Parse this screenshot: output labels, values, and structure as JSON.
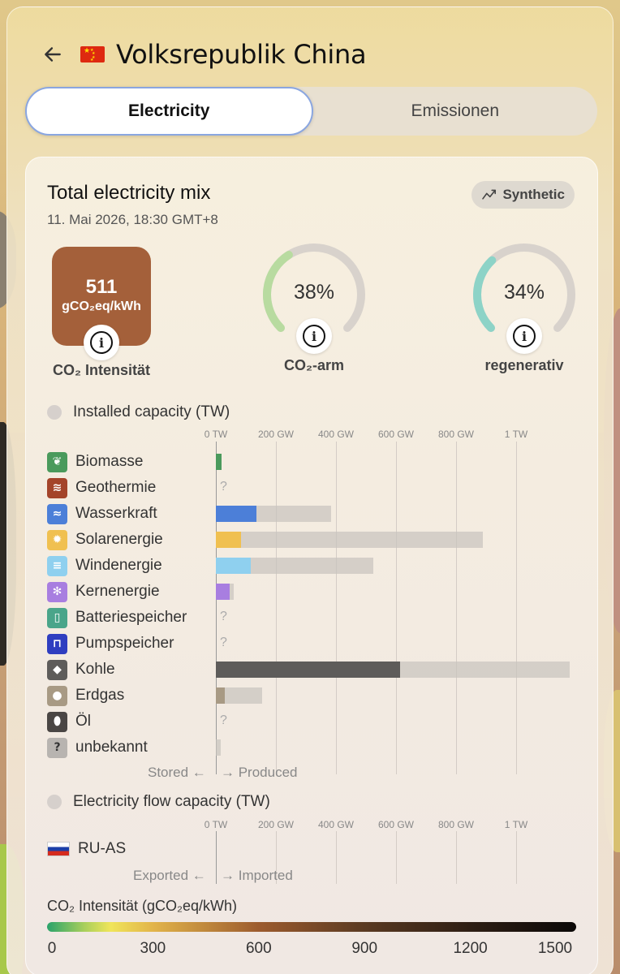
{
  "header": {
    "title": "Volksrepublik China"
  },
  "tabs": [
    {
      "label": "Electricity",
      "active": true
    },
    {
      "label": "Emissionen",
      "active": false
    }
  ],
  "card": {
    "title": "Total electricity mix",
    "date": "11. Mai 2026, 18:30 GMT+8",
    "badge": "Synthetic"
  },
  "metrics": {
    "intensity_value": "511",
    "intensity_unit": "gCO₂eq/kWh",
    "intensity_label": "CO₂ Intensität",
    "low_carbon_value": "38%",
    "low_carbon_fraction": 0.38,
    "low_carbon_label": "CO₂-arm",
    "renewable_value": "34%",
    "renewable_fraction": 0.34,
    "renewable_label": "regenerativ",
    "intensity_color": "#a4603a",
    "low_carbon_color": "#b8dba0",
    "renewable_color": "#8dd3c7"
  },
  "capacity": {
    "title": "Installed capacity (TW)",
    "axis_ticks": [
      "0 TW",
      "200 GW",
      "400 GW",
      "600 GW",
      "800 GW",
      "1 TW"
    ],
    "rows": [
      {
        "label": "Biomasse",
        "icon": "leaf-icon",
        "color": "#4a9a5c",
        "produced_gw": 18,
        "capacity_gw": 18,
        "unknown": false
      },
      {
        "label": "Geothermie",
        "icon": "geothermal-icon",
        "color": "#a4442a",
        "produced_gw": 0,
        "capacity_gw": 0,
        "unknown": true
      },
      {
        "label": "Wasserkraft",
        "icon": "water-icon",
        "color": "#4c7fd8",
        "produced_gw": 135,
        "capacity_gw": 385,
        "unknown": false
      },
      {
        "label": "Solarenergie",
        "icon": "sun-icon",
        "color": "#f0c050",
        "produced_gw": 85,
        "capacity_gw": 890,
        "unknown": false
      },
      {
        "label": "Windenergie",
        "icon": "wind-icon",
        "color": "#8fd0ef",
        "produced_gw": 115,
        "capacity_gw": 525,
        "unknown": false
      },
      {
        "label": "Kernenergie",
        "icon": "atom-icon",
        "color": "#a87ee0",
        "produced_gw": 46,
        "capacity_gw": 60,
        "unknown": false
      },
      {
        "label": "Batteriespeicher",
        "icon": "battery-icon",
        "color": "#4aa58a",
        "produced_gw": 0,
        "capacity_gw": 0,
        "unknown": true
      },
      {
        "label": "Pumpspeicher",
        "icon": "pumped-storage-icon",
        "color": "#2f3ec0",
        "produced_gw": 0,
        "capacity_gw": 0,
        "unknown": true
      },
      {
        "label": "Kohle",
        "icon": "coal-icon",
        "color": "#5e5c5a",
        "produced_gw": 613,
        "capacity_gw": 1180,
        "unknown": false
      },
      {
        "label": "Erdgas",
        "icon": "gas-icon",
        "color": "#a89a84",
        "produced_gw": 30,
        "capacity_gw": 155,
        "unknown": false
      },
      {
        "label": "Öl",
        "icon": "oil-icon",
        "color": "#4a4644",
        "produced_gw": 0,
        "capacity_gw": 0,
        "unknown": true
      },
      {
        "label": "unbekannt",
        "icon": "question-icon",
        "color": "#b8b4b0",
        "produced_gw": 0,
        "capacity_gw": 15,
        "unknown": false
      }
    ],
    "stored_label": "Stored ←",
    "produced_label": "→ Produced"
  },
  "flow": {
    "title": "Electricity flow capacity (TW)",
    "axis_ticks": [
      "0 TW",
      "200 GW",
      "400 GW",
      "600 GW",
      "800 GW",
      "1 TW"
    ],
    "rows": [
      {
        "label": "RU-AS"
      }
    ],
    "exported_label": "Exported ←",
    "imported_label": "→ Imported"
  },
  "scale": {
    "title": "CO₂ Intensität (gCO₂eq/kWh)",
    "ticks": [
      "0",
      "300",
      "600",
      "900",
      "1200",
      "1500"
    ]
  }
}
